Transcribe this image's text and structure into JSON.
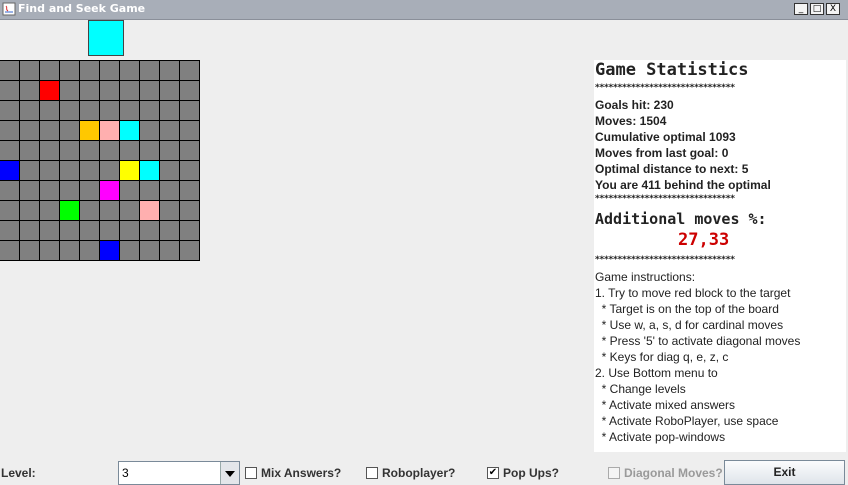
{
  "window": {
    "title": "Find and Seek Game",
    "controls": {
      "minimize": "_",
      "maximize": "□",
      "close": "X"
    }
  },
  "target": {
    "color": "#00ffff"
  },
  "board": {
    "rows": 10,
    "cols": 10,
    "empty_color": "#808080",
    "colored_cells": [
      {
        "row": 1,
        "col": 2,
        "color": "#ff0000"
      },
      {
        "row": 3,
        "col": 4,
        "color": "#ffc800"
      },
      {
        "row": 3,
        "col": 5,
        "color": "#ffafaf"
      },
      {
        "row": 3,
        "col": 6,
        "color": "#00ffff"
      },
      {
        "row": 5,
        "col": 0,
        "color": "#0000ff"
      },
      {
        "row": 5,
        "col": 6,
        "color": "#ffff00"
      },
      {
        "row": 5,
        "col": 7,
        "color": "#00ffff"
      },
      {
        "row": 6,
        "col": 5,
        "color": "#ff00ff"
      },
      {
        "row": 7,
        "col": 3,
        "color": "#00ff00"
      },
      {
        "row": 7,
        "col": 7,
        "color": "#ffafaf"
      },
      {
        "row": 9,
        "col": 5,
        "color": "#0000ff"
      }
    ]
  },
  "stats": {
    "heading": "Game Statistics",
    "stars": "*******************************",
    "goals_hit": "Goals hit: 230",
    "moves": "Moves: 1504",
    "cumulative_optimal": "Cumulative optimal 1093",
    "moves_from_last_goal": "Moves from last goal: 0",
    "optimal_distance": "Optimal distance to next: 5",
    "behind_optimal": "You are 411 behind the optimal",
    "additional_label": "Additional moves %:",
    "additional_value": "27,33",
    "instructions": [
      "Game instructions:",
      "1. Try to move red block to the target",
      "  * Target is on the top of the board",
      "  * Use w, a, s, d for cardinal moves",
      "  * Press '5' to activate diagonal moves",
      "  * Keys for diag q, e, z, c",
      "2. Use Bottom menu to",
      "  * Change levels",
      "  * Activate mixed answers",
      "  * Activate RoboPlayer, use space",
      "  * Activate pop-windows"
    ]
  },
  "bottom": {
    "level_label": "Level:",
    "level_value": "3",
    "mix_answers": {
      "label": "Mix Answers?",
      "checked": false
    },
    "roboplayer": {
      "label": "Roboplayer?",
      "checked": false
    },
    "popups": {
      "label": "Pop Ups?",
      "checked": true
    },
    "diagonal": {
      "label": "Diagonal Moves?",
      "checked": false,
      "disabled": true
    },
    "exit_label": "Exit"
  }
}
